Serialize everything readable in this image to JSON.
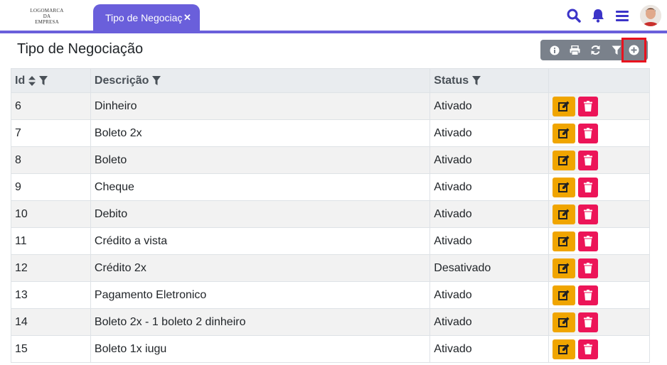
{
  "logo": {
    "line1": "LOGOMARCA",
    "line2": "DA",
    "line3": "EMPRESA"
  },
  "tab": {
    "label": "Tipo de Negociação",
    "close": "✕"
  },
  "top_icons": [
    "search-icon",
    "bell-icon",
    "menu-icon"
  ],
  "colors": {
    "accent": "#6a5fdb",
    "icon": "#3c34c8",
    "edit": "#f0a500",
    "delete": "#ec1558",
    "toolbar": "#7a818b",
    "highlight": "#e8121e"
  },
  "page": {
    "title": "Tipo de Negociação"
  },
  "toolbar": {
    "buttons": [
      "info-icon",
      "print-icon",
      "refresh-icon",
      "filter-icon",
      "add-icon"
    ]
  },
  "table": {
    "headers": {
      "id": "Id",
      "description": "Descrição",
      "status": "Status"
    },
    "rows": [
      {
        "id": "6",
        "description": "Dinheiro",
        "status": "Ativado"
      },
      {
        "id": "7",
        "description": "Boleto 2x",
        "status": "Ativado"
      },
      {
        "id": "8",
        "description": "Boleto",
        "status": "Ativado"
      },
      {
        "id": "9",
        "description": "Cheque",
        "status": "Ativado"
      },
      {
        "id": "10",
        "description": "Debito",
        "status": "Ativado"
      },
      {
        "id": "11",
        "description": "Crédito a vista",
        "status": "Ativado"
      },
      {
        "id": "12",
        "description": "Crédito 2x",
        "status": "Desativado"
      },
      {
        "id": "13",
        "description": "Pagamento Eletronico",
        "status": "Ativado"
      },
      {
        "id": "14",
        "description": "Boleto 2x - 1 boleto 2 dinheiro",
        "status": "Ativado"
      },
      {
        "id": "15",
        "description": "Boleto 1x iugu",
        "status": "Ativado"
      }
    ]
  }
}
